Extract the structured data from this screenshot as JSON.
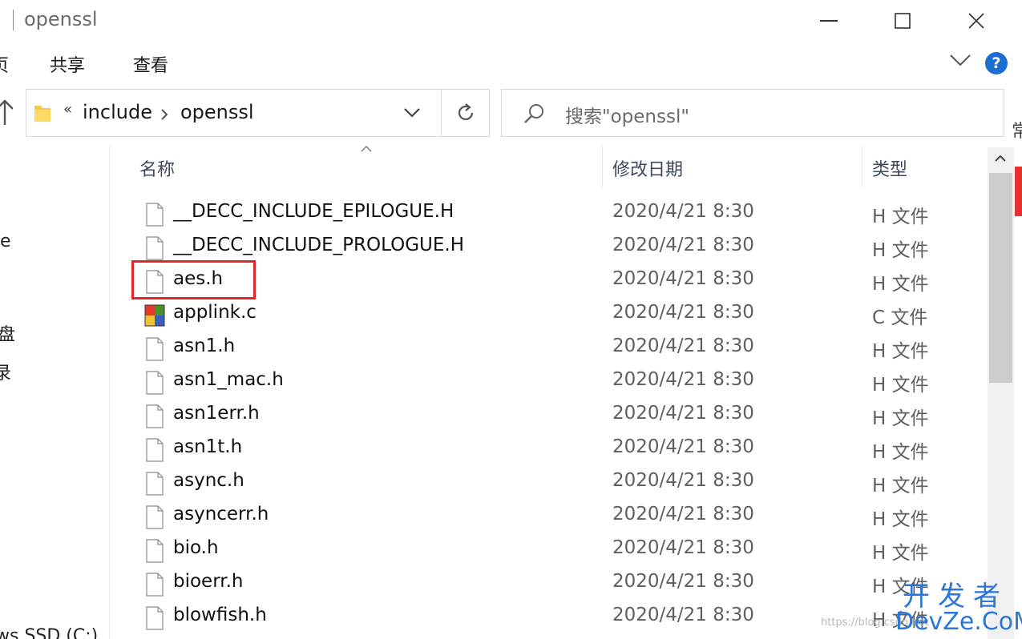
{
  "window": {
    "title": "openssl"
  },
  "ribbon": {
    "tabs": [
      "页",
      "共享",
      "查看"
    ]
  },
  "address_bar": {
    "overflow": "«",
    "crumbs": [
      "include",
      "openssl"
    ]
  },
  "search": {
    "placeholder": "搜索\"openssl\""
  },
  "right_clipped_text": "常",
  "nav_pane": {
    "items": [
      "e",
      "盘",
      "录",
      "ws SSD (C:)"
    ]
  },
  "columns": {
    "name": "名称",
    "date": "修改日期",
    "type": "类型"
  },
  "files": [
    {
      "name": "__DECC_INCLUDE_EPILOGUE.H",
      "date": "2020/4/21 8:30",
      "type": "H 文件",
      "icon": "blank-file-icon"
    },
    {
      "name": "__DECC_INCLUDE_PROLOGUE.H",
      "date": "2020/4/21 8:30",
      "type": "H 文件",
      "icon": "blank-file-icon"
    },
    {
      "name": "aes.h",
      "date": "2020/4/21 8:30",
      "type": "H 文件",
      "icon": "blank-file-icon"
    },
    {
      "name": "applink.c",
      "date": "2020/4/21 8:30",
      "type": "C 文件",
      "icon": "c-source-file-icon"
    },
    {
      "name": "asn1.h",
      "date": "2020/4/21 8:30",
      "type": "H 文件",
      "icon": "blank-file-icon"
    },
    {
      "name": "asn1_mac.h",
      "date": "2020/4/21 8:30",
      "type": "H 文件",
      "icon": "blank-file-icon"
    },
    {
      "name": "asn1err.h",
      "date": "2020/4/21 8:30",
      "type": "H 文件",
      "icon": "blank-file-icon"
    },
    {
      "name": "asn1t.h",
      "date": "2020/4/21 8:30",
      "type": "H 文件",
      "icon": "blank-file-icon"
    },
    {
      "name": "async.h",
      "date": "2020/4/21 8:30",
      "type": "H 文件",
      "icon": "blank-file-icon"
    },
    {
      "name": "asyncerr.h",
      "date": "2020/4/21 8:30",
      "type": "H 文件",
      "icon": "blank-file-icon"
    },
    {
      "name": "bio.h",
      "date": "2020/4/21 8:30",
      "type": "H 文件",
      "icon": "blank-file-icon"
    },
    {
      "name": "bioerr.h",
      "date": "2020/4/21 8:30",
      "type": "H 文件",
      "icon": "blank-file-icon"
    },
    {
      "name": "blowfish.h",
      "date": "2020/4/21 8:30",
      "type": "H 文件",
      "icon": "blank-file-icon"
    }
  ],
  "highlighted_file": "aes.h",
  "highlight_color": "#e0262b",
  "watermark": {
    "url": "https://blog.csdn.net",
    "brand_top": "开发者",
    "brand_bottom": "DevZe.CoM"
  }
}
